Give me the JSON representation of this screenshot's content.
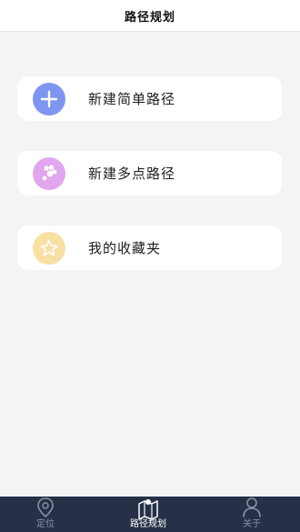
{
  "header": {
    "title": "路径规划"
  },
  "menu": {
    "items": [
      {
        "label": "新建简单路径",
        "icon": "plus-icon",
        "color": "#7f95f2"
      },
      {
        "label": "新建多点路径",
        "icon": "paw-icon",
        "color": "#e0a6ee"
      },
      {
        "label": "我的收藏夹",
        "icon": "star-icon",
        "color": "#f8dfa2"
      }
    ]
  },
  "tabbar": {
    "active_index": 1,
    "active_color": "#ffffff",
    "inactive_color": "#8a93a6",
    "tabs": [
      {
        "label": "定位",
        "icon": "location-pin-icon"
      },
      {
        "label": "路径规划",
        "icon": "route-map-icon"
      },
      {
        "label": "关于",
        "icon": "user-icon"
      }
    ]
  }
}
